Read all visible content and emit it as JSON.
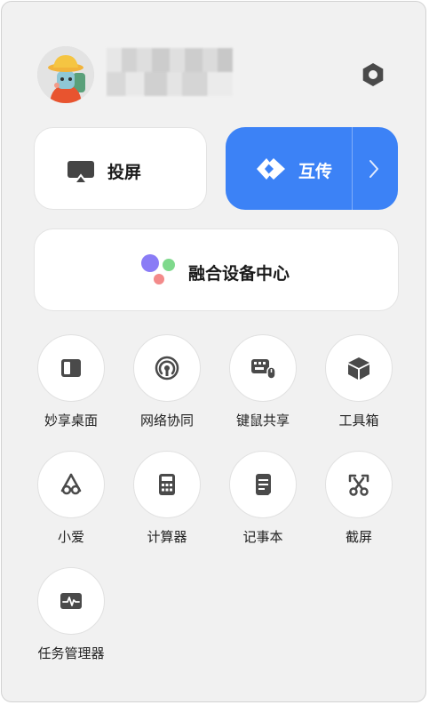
{
  "header": {
    "username": "",
    "avatar_icon": "cartoon-avatar",
    "settings_icon": "hexagon-settings-icon"
  },
  "main_actions": {
    "cast_label": "投屏",
    "transfer_label": "互传",
    "fusion_label": "融合设备中心"
  },
  "colors": {
    "accent": "#3c82f6",
    "panel_bg": "#f1f1f1",
    "icon": "#4a4a4a"
  },
  "tools": [
    {
      "label": "妙享桌面",
      "icon": "split-window-icon"
    },
    {
      "label": "网络协同",
      "icon": "broadcast-icon"
    },
    {
      "label": "键鼠共享",
      "icon": "keyboard-mouse-icon"
    },
    {
      "label": "工具箱",
      "icon": "box-icon"
    },
    {
      "label": "小爱",
      "icon": "xiaoai-icon"
    },
    {
      "label": "计算器",
      "icon": "calculator-icon"
    },
    {
      "label": "记事本",
      "icon": "notepad-icon"
    },
    {
      "label": "截屏",
      "icon": "screenshot-scissors-icon"
    },
    {
      "label": "任务管理器",
      "icon": "task-monitor-icon"
    }
  ]
}
